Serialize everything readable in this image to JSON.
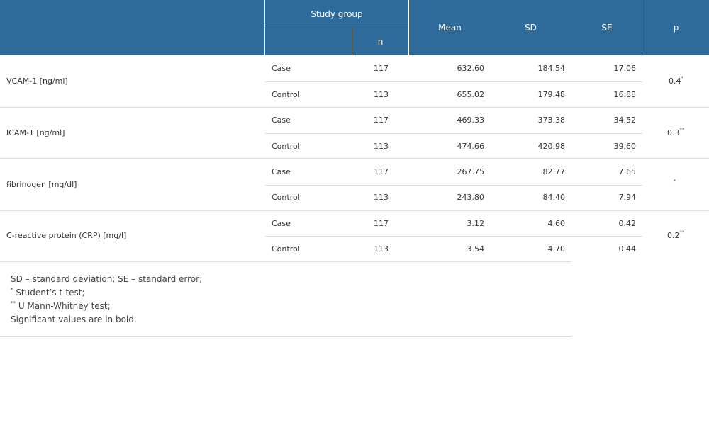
{
  "header": {
    "study_group": "Study group",
    "n": "n",
    "mean": "Mean",
    "sd": "SD",
    "se": "SE",
    "p": "p"
  },
  "rows": [
    {
      "label": "VCAM-1 [ng/ml]",
      "p": "0.4",
      "p_sup": "*",
      "groups": [
        {
          "group": "Case",
          "n": "117",
          "mean": "632.60",
          "sd": "184.54",
          "se": "17.06"
        },
        {
          "group": "Control",
          "n": "113",
          "mean": "655.02",
          "sd": "179.48",
          "se": "16.88"
        }
      ]
    },
    {
      "label": "ICAM-1 [ng/ml]",
      "p": "0.3",
      "p_sup": "**",
      "groups": [
        {
          "group": "Case",
          "n": "117",
          "mean": "469.33",
          "sd": "373.38",
          "se": "34.52"
        },
        {
          "group": "Control",
          "n": "113",
          "mean": "474.66",
          "sd": "420.98",
          "se": "39.60"
        }
      ]
    },
    {
      "label": "fibrinogen [mg/dl]",
      "p": "",
      "p_sup": "*",
      "groups": [
        {
          "group": "Case",
          "n": "117",
          "mean": "267.75",
          "sd": "82.77",
          "se": "7.65"
        },
        {
          "group": "Control",
          "n": "113",
          "mean": "243.80",
          "sd": "84.40",
          "se": "7.94"
        }
      ]
    },
    {
      "label": "C-reactive protein (CRP) [mg/l]",
      "p": "0.2",
      "p_sup": "**",
      "groups": [
        {
          "group": "Case",
          "n": "117",
          "mean": "3.12",
          "sd": "4.60",
          "se": "0.42"
        },
        {
          "group": "Control",
          "n": "113",
          "mean": "3.54",
          "sd": "4.70",
          "se": "0.44"
        }
      ]
    }
  ],
  "footnotes": {
    "line1": "SD – standard deviation; SE – standard error;",
    "line2_mark": "*",
    "line2": " Student’s t-test;",
    "line3_mark": "**",
    "line3": " U Mann-Whitney test;",
    "line4": "Significant values are in bold."
  },
  "colors": {
    "header_bg": "#2f6b9a",
    "header_text": "#ffffff",
    "rule": "#dcdcdc"
  }
}
